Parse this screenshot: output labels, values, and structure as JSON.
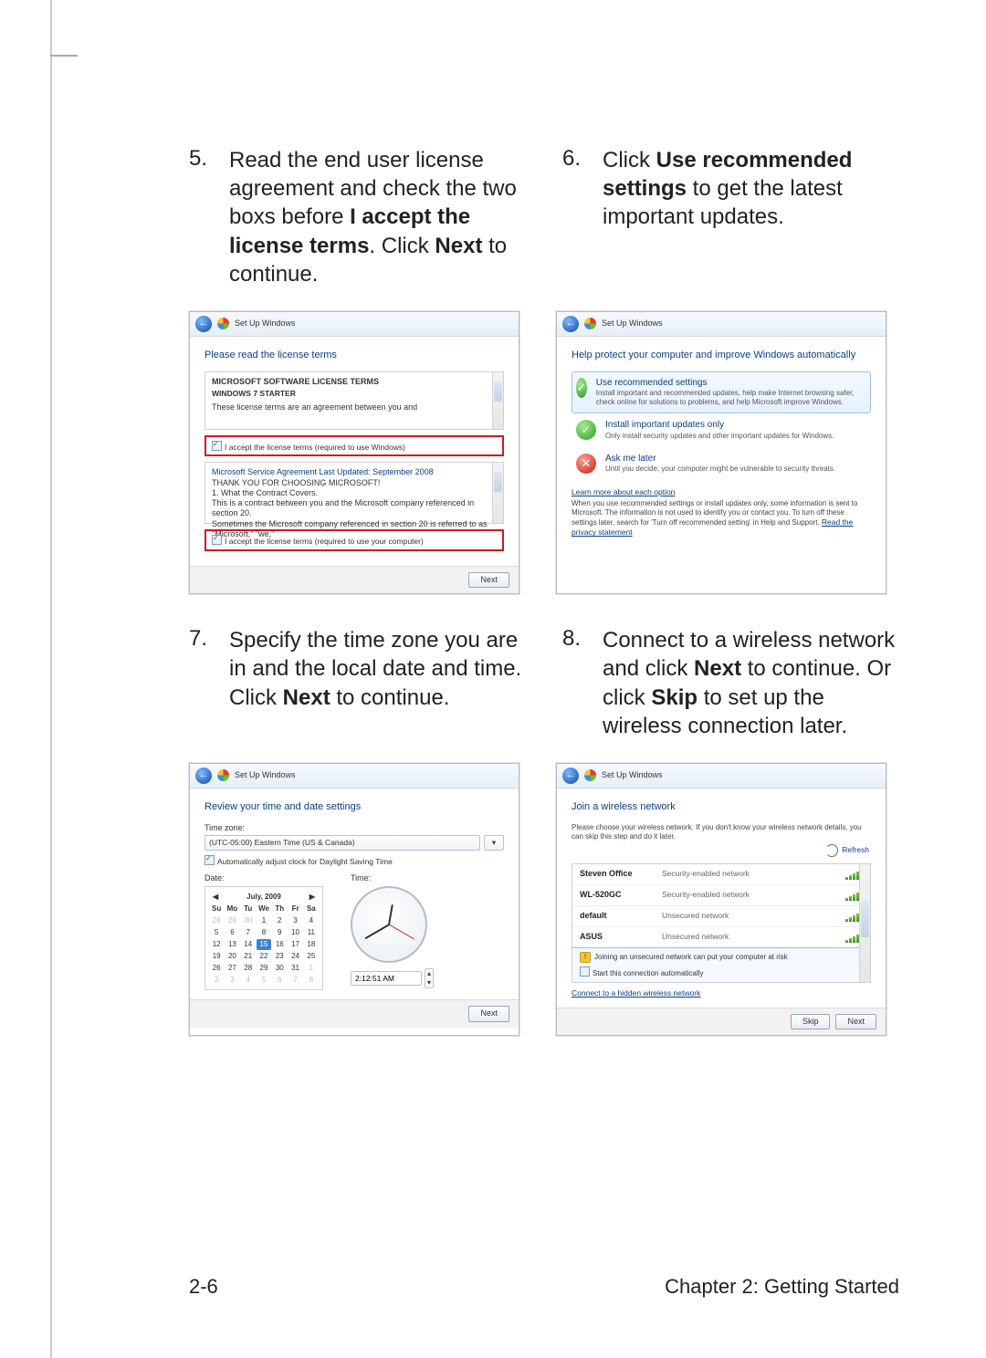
{
  "steps": {
    "s5": {
      "num": "5.",
      "text_a": "Read the end user license agreement and check the two boxs before ",
      "bold_a": "I accept the license terms",
      "text_b": ". Click ",
      "bold_b": "Next",
      "text_c": " to continue."
    },
    "s6": {
      "num": "6.",
      "text_a": "Click ",
      "bold_a": "Use recommended settings",
      "text_b": " to get the latest important updates."
    },
    "s7": {
      "num": "7.",
      "text_a": "Specify the time zone you are in and the local date and time. Click ",
      "bold_a": "Next",
      "text_b": " to continue."
    },
    "s8": {
      "num": "8.",
      "text_a": "Connect to a wireless network and click ",
      "bold_a": "Next",
      "text_b": " to continue. Or click ",
      "bold_b": "Skip",
      "text_c": " to set up the wireless connection later."
    }
  },
  "win": {
    "title": "Set Up Windows",
    "next": "Next",
    "skip": "Skip"
  },
  "shot5": {
    "heading": "Please read the license terms",
    "l1": "MICROSOFT SOFTWARE LICENSE TERMS",
    "l2": "WINDOWS 7 STARTER",
    "l3": "These license terms are an agreement between you and",
    "chk1": "I accept the license terms (required to use Windows)",
    "ag1": "Microsoft Service Agreement Last Updated: September 2008",
    "ag2": "THANK YOU FOR CHOOSING MICROSOFT!",
    "ag3": "1. What the Contract Covers.",
    "ag4": "This is a contract between you and the Microsoft company referenced in section 20.",
    "ag5": "Sometimes the Microsoft company referenced in section 20 is referred to as \"Microsoft,\" \"we,\"",
    "chk2": "I accept the license terms (required to use your computer)"
  },
  "shot6": {
    "heading": "Help protect your computer and improve Windows automatically",
    "o1_title": "Use recommended settings",
    "o1_desc": "Install important and recommended updates, help make Internet browsing safer, check online for solutions to problems, and help Microsoft improve Windows.",
    "o2_title": "Install important updates only",
    "o2_desc": "Only install security updates and other important updates for Windows.",
    "o3_title": "Ask me later",
    "o3_desc": "Until you decide, your computer might be vulnerable to security threats.",
    "learn": "Learn more about each option",
    "fine": "When you use recommended settings or install updates only, some information is sent to Microsoft. The information is not used to identify you or contact you. To turn off these settings later, search for 'Turn off recommended setting' in Help and Support. ",
    "readpriv": "Read the privacy statement"
  },
  "shot7": {
    "heading": "Review your time and date settings",
    "tz_label": "Time zone:",
    "tz_value": "(UTC-05:00) Eastern Time (US & Canada)",
    "tz_dst": "Automatically adjust clock for Daylight Saving Time",
    "date_label": "Date:",
    "time_label": "Time:",
    "month": "July, 2009",
    "dow": [
      "Su",
      "Mo",
      "Tu",
      "We",
      "Th",
      "Fr",
      "Sa"
    ],
    "cells": [
      {
        "v": "28",
        "dim": true
      },
      {
        "v": "29",
        "dim": true
      },
      {
        "v": "30",
        "dim": true
      },
      {
        "v": "1"
      },
      {
        "v": "2"
      },
      {
        "v": "3"
      },
      {
        "v": "4"
      },
      {
        "v": "5"
      },
      {
        "v": "6"
      },
      {
        "v": "7"
      },
      {
        "v": "8"
      },
      {
        "v": "9"
      },
      {
        "v": "10"
      },
      {
        "v": "11"
      },
      {
        "v": "12"
      },
      {
        "v": "13"
      },
      {
        "v": "14"
      },
      {
        "v": "15",
        "today": true
      },
      {
        "v": "16"
      },
      {
        "v": "17"
      },
      {
        "v": "18"
      },
      {
        "v": "19"
      },
      {
        "v": "20"
      },
      {
        "v": "21"
      },
      {
        "v": "22"
      },
      {
        "v": "23"
      },
      {
        "v": "24"
      },
      {
        "v": "25"
      },
      {
        "v": "26"
      },
      {
        "v": "27"
      },
      {
        "v": "28"
      },
      {
        "v": "29"
      },
      {
        "v": "30"
      },
      {
        "v": "31"
      },
      {
        "v": "1",
        "dim": true
      },
      {
        "v": "2",
        "dim": true
      },
      {
        "v": "3",
        "dim": true
      },
      {
        "v": "4",
        "dim": true
      },
      {
        "v": "5",
        "dim": true
      },
      {
        "v": "6",
        "dim": true
      },
      {
        "v": "7",
        "dim": true
      },
      {
        "v": "8",
        "dim": true
      }
    ],
    "time_value": "2:12:51 AM"
  },
  "shot8": {
    "heading": "Join a wireless network",
    "note": "Please choose your wireless network. If you don't know your wireless network details, you can skip this step and do it later.",
    "refresh": "Refresh",
    "networks": [
      {
        "name": "Steven Office",
        "sec": "Security-enabled network"
      },
      {
        "name": "WL-520GC",
        "sec": "Security-enabled network"
      },
      {
        "name": "default",
        "sec": "Unsecured network"
      },
      {
        "name": "ASUS",
        "sec": "Unsecured network"
      }
    ],
    "warn": "Joining an unsecured network can put your computer at risk",
    "auto": "Start this connection automatically",
    "hidden": "Connect to a hidden wireless network"
  },
  "footer": {
    "pagenum": "2-6",
    "chapter": "Chapter 2: Getting Started"
  }
}
